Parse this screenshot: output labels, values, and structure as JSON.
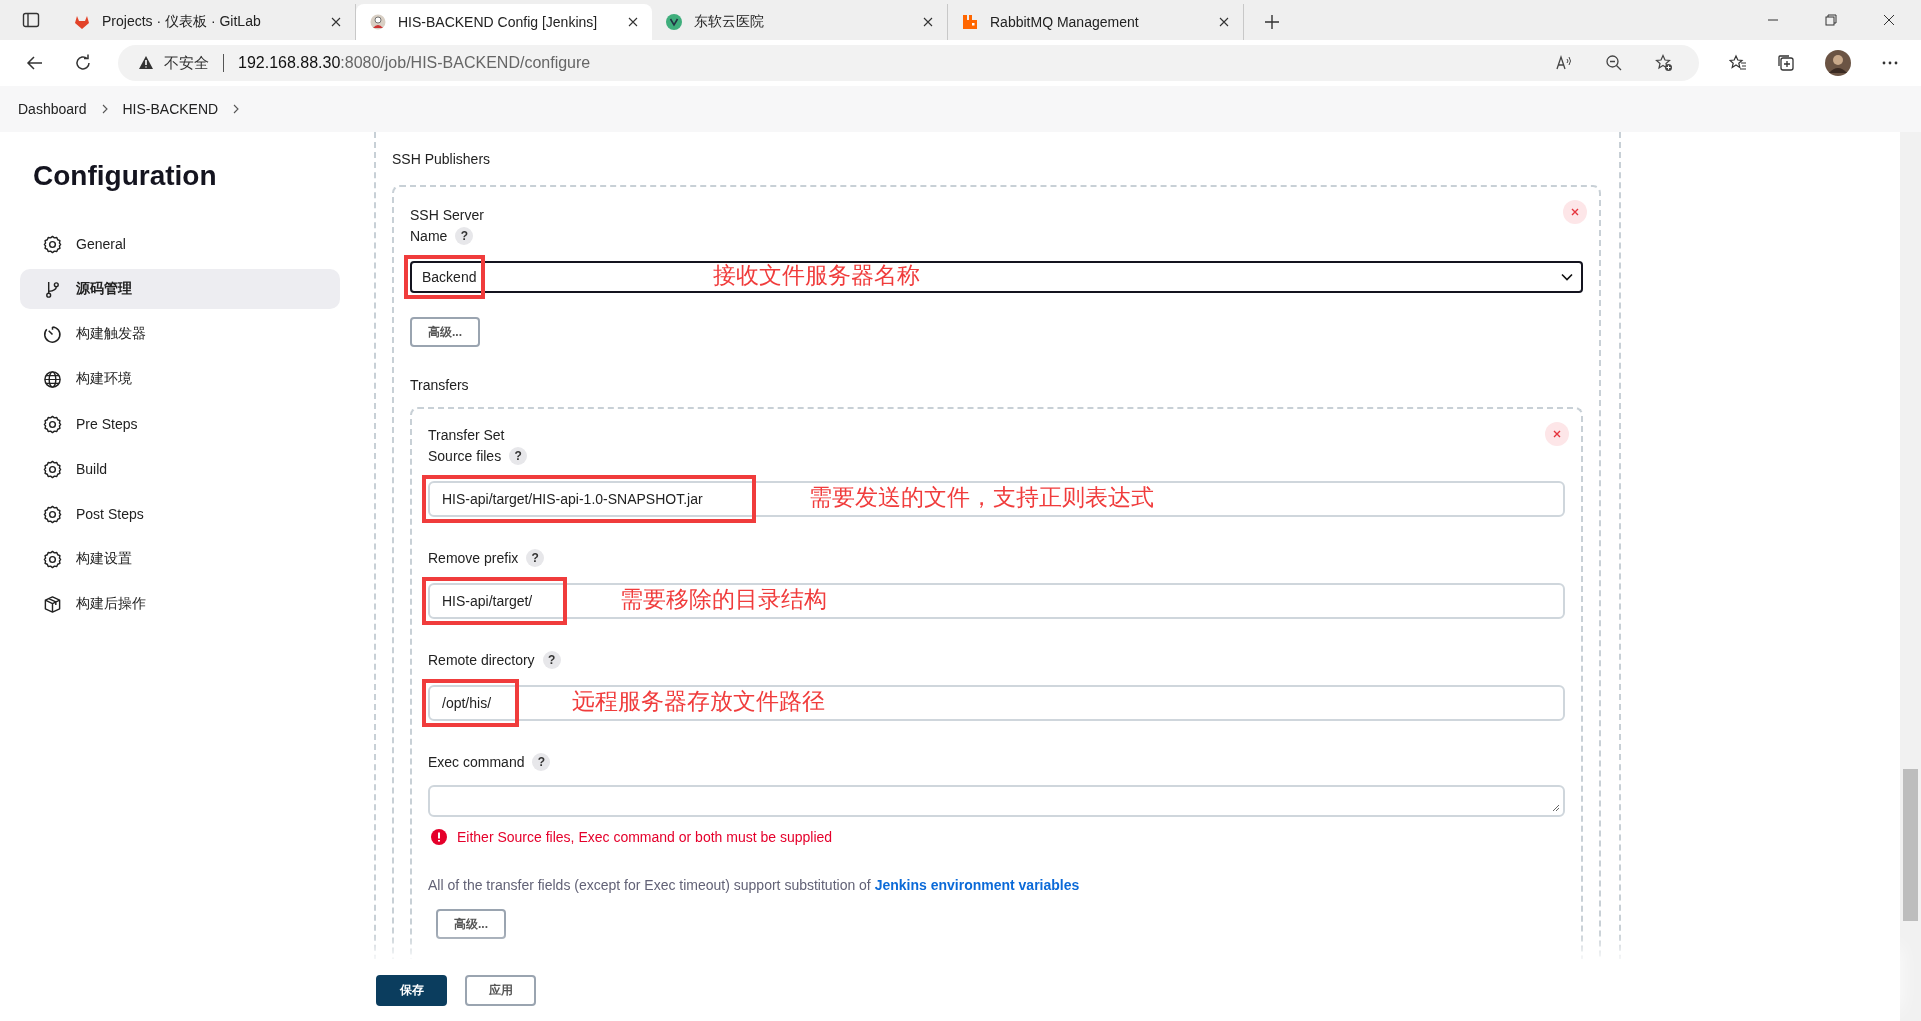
{
  "browser": {
    "tabs": [
      {
        "title": "Projects · 仪表板 · GitLab",
        "selected": false
      },
      {
        "title": "HIS-BACKEND Config [Jenkins]",
        "selected": true
      },
      {
        "title": "东软云医院",
        "selected": false
      },
      {
        "title": "RabbitMQ Management",
        "selected": false
      }
    ],
    "address": {
      "security": "不安全",
      "host": "192.168.88.30",
      "path": ":8080/job/HIS-BACKEND/configure"
    }
  },
  "breadcrumb": [
    "Dashboard",
    "HIS-BACKEND"
  ],
  "sidebar": {
    "title": "Configuration",
    "items": [
      {
        "label": "General",
        "selected": false
      },
      {
        "label": "源码管理",
        "selected": true
      },
      {
        "label": "构建触发器",
        "selected": false
      },
      {
        "label": "构建环境",
        "selected": false
      },
      {
        "label": "Pre Steps",
        "selected": false
      },
      {
        "label": "Build",
        "selected": false
      },
      {
        "label": "Post Steps",
        "selected": false
      },
      {
        "label": "构建设置",
        "selected": false
      },
      {
        "label": "构建后操作",
        "selected": false
      }
    ]
  },
  "section": {
    "title": "SSH Publishers",
    "server": {
      "title": "SSH Server",
      "name_label": "Name",
      "help": "?",
      "name_value": "Backend",
      "annotation": "接收文件服务器名称",
      "advanced_button": "高级..."
    },
    "transfers_label": "Transfers",
    "transfer_set": {
      "title": "Transfer Set",
      "fields": [
        {
          "kind": "input",
          "label": "Source files",
          "help": "?",
          "value": "HIS-api/target/HIS-api-1.0-SNAPSHOT.jar",
          "annotation": "需要发送的文件，支持正则表达式"
        },
        {
          "kind": "input",
          "label": "Remove prefix",
          "help": "?",
          "value": "HIS-api/target/",
          "annotation": "需要移除的目录结构"
        },
        {
          "kind": "input",
          "label": "Remote directory",
          "help": "?",
          "value": "/opt/his/",
          "annotation": "远程服务器存放文件路径"
        },
        {
          "kind": "textarea",
          "label": "Exec command",
          "help": "?",
          "error": "Either Source files, Exec command or both must be supplied"
        }
      ],
      "note": "All of the transfer fields (except for Exec timeout) support substitution of",
      "note_link": "Jenkins environment variables",
      "advanced_button": "高级..."
    }
  },
  "footer": {
    "buttons": [
      {
        "label": "保存",
        "kind": "primary"
      },
      {
        "label": "应用",
        "kind": "secondary"
      }
    ]
  }
}
